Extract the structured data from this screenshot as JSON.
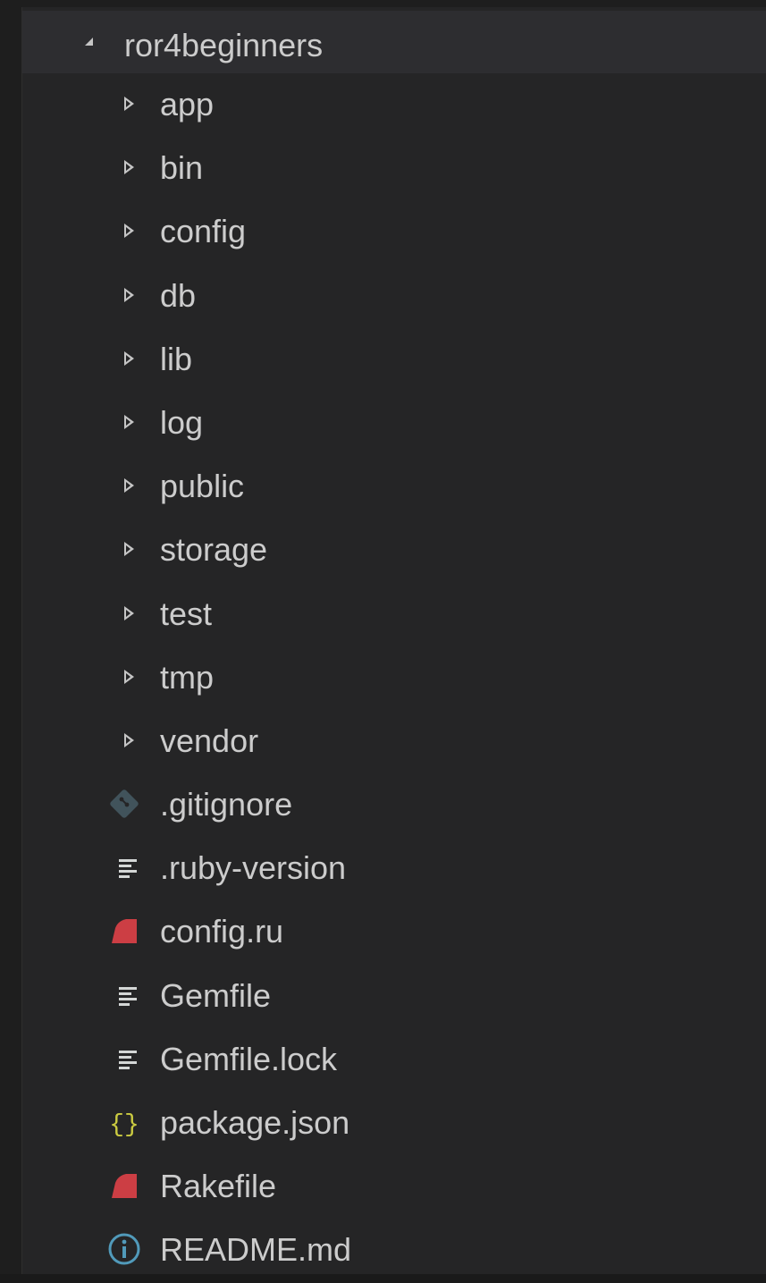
{
  "explorer": {
    "root": {
      "label": "ror4beginners",
      "expanded": true
    },
    "folders": [
      {
        "label": "app",
        "icon": "chevron-right-icon"
      },
      {
        "label": "bin",
        "icon": "chevron-right-icon"
      },
      {
        "label": "config",
        "icon": "chevron-right-icon"
      },
      {
        "label": "db",
        "icon": "chevron-right-icon"
      },
      {
        "label": "lib",
        "icon": "chevron-right-icon"
      },
      {
        "label": "log",
        "icon": "chevron-right-icon"
      },
      {
        "label": "public",
        "icon": "chevron-right-icon"
      },
      {
        "label": "storage",
        "icon": "chevron-right-icon"
      },
      {
        "label": "test",
        "icon": "chevron-right-icon"
      },
      {
        "label": "tmp",
        "icon": "chevron-right-icon"
      },
      {
        "label": "vendor",
        "icon": "chevron-right-icon"
      }
    ],
    "files": [
      {
        "label": ".gitignore",
        "icon": "git-icon",
        "color": "#41535b"
      },
      {
        "label": ".ruby-version",
        "icon": "text-lines-icon",
        "color": "#d4d7d6"
      },
      {
        "label": "config.ru",
        "icon": "ruby-icon",
        "color": "#cc3e44"
      },
      {
        "label": "Gemfile",
        "icon": "text-lines-icon",
        "color": "#d4d7d6"
      },
      {
        "label": "Gemfile.lock",
        "icon": "text-lines-icon",
        "color": "#d4d7d6"
      },
      {
        "label": "package.json",
        "icon": "json-braces-icon",
        "color": "#cbcb41"
      },
      {
        "label": "Rakefile",
        "icon": "ruby-icon",
        "color": "#cc3e44"
      },
      {
        "label": "README.md",
        "icon": "info-icon",
        "color": "#519aba"
      }
    ]
  },
  "colors": {
    "panel_background": "#252526",
    "root_row_background": "#2d2d30",
    "text": "#cccccc"
  }
}
